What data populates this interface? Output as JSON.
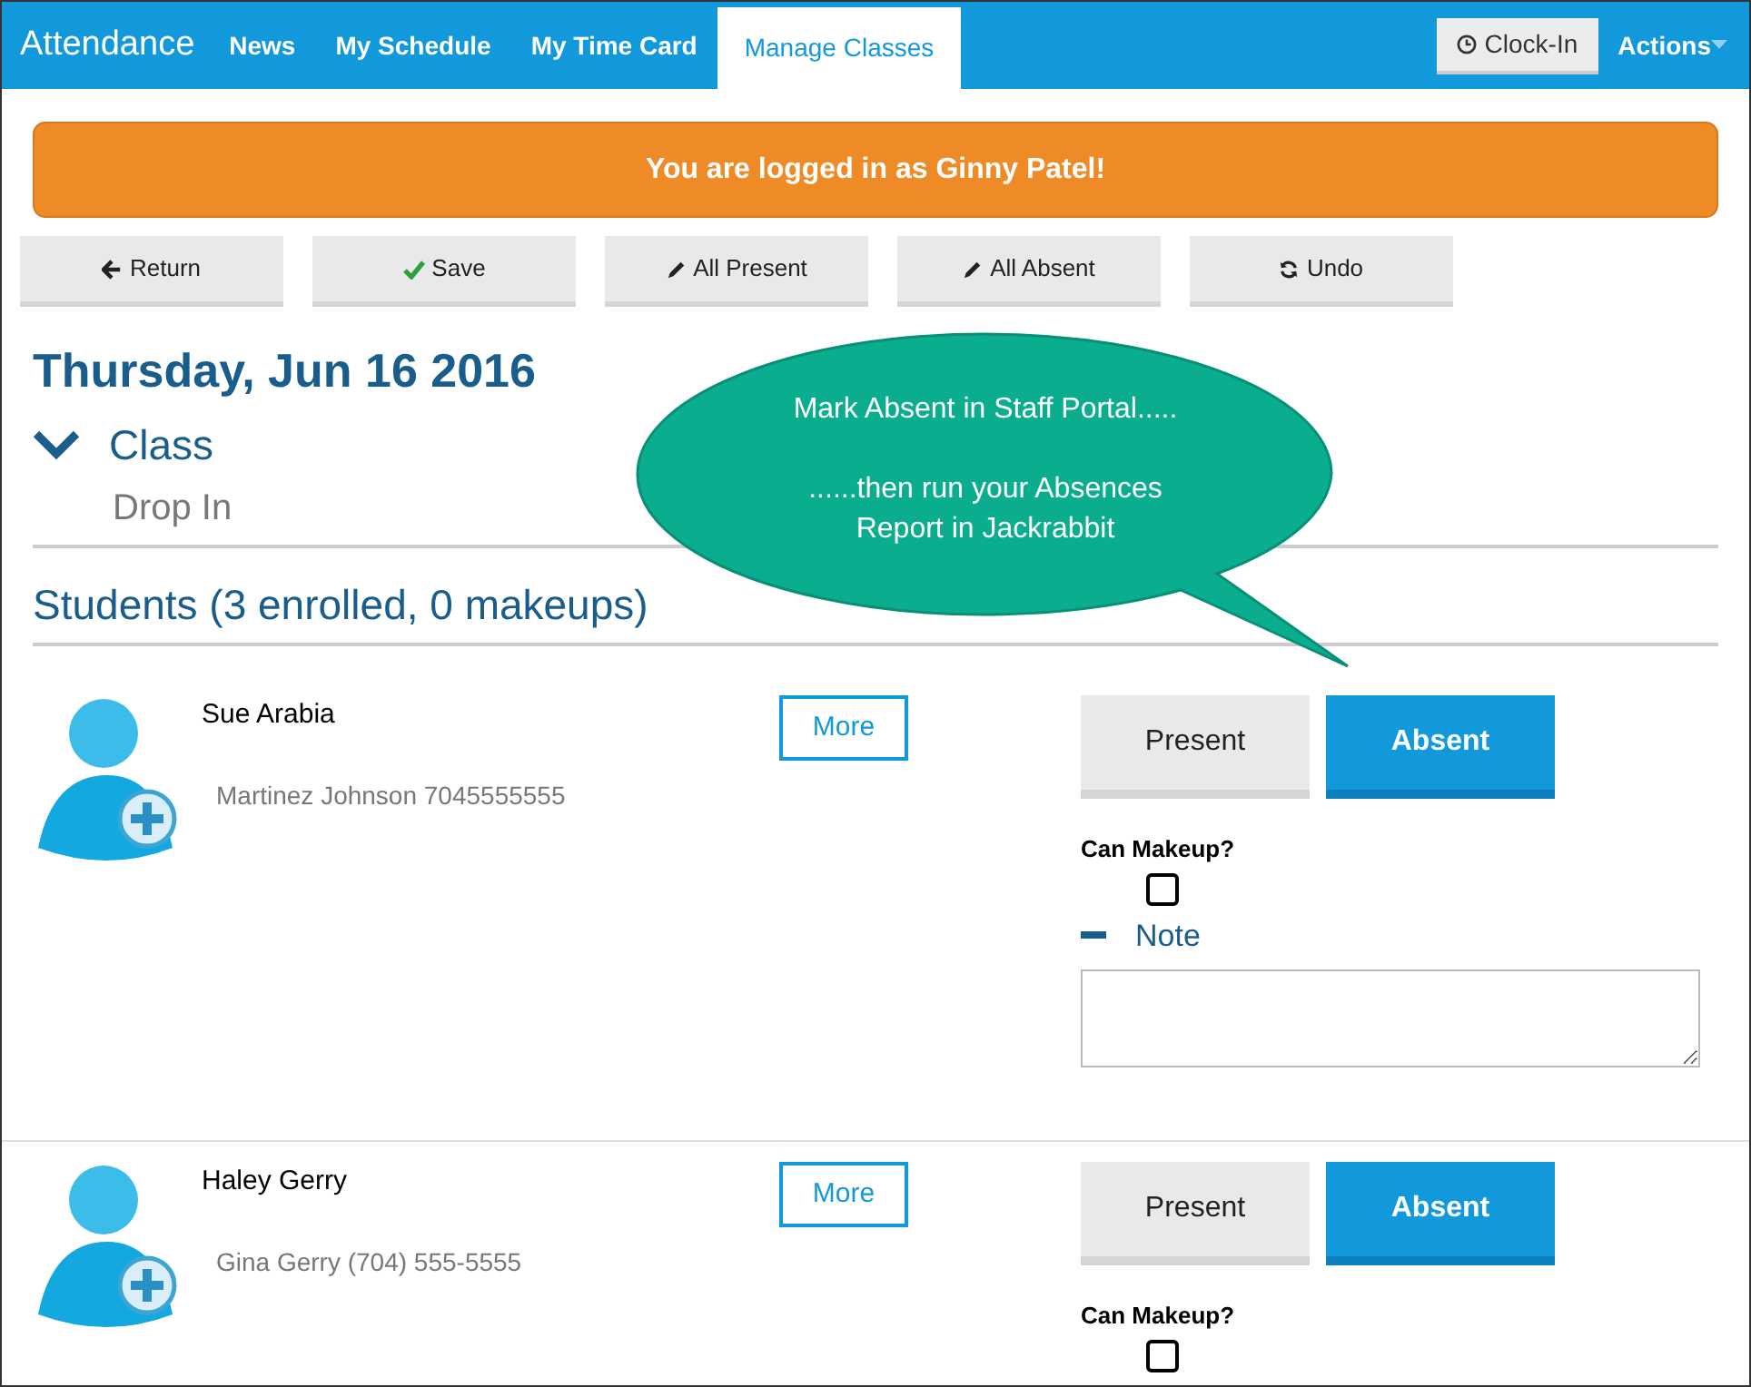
{
  "nav": {
    "brand": "Attendance",
    "tabs": [
      {
        "label": "News",
        "selected": false
      },
      {
        "label": "My Schedule",
        "selected": false
      },
      {
        "label": "My Time Card",
        "selected": false
      },
      {
        "label": "Manage Classes",
        "selected": true
      }
    ],
    "clock_in": "Clock-In",
    "actions": "Actions"
  },
  "alert": "You are logged in as Ginny Patel!",
  "toolbar": [
    {
      "label": "Return"
    },
    {
      "label": "Save"
    },
    {
      "label": "All Present"
    },
    {
      "label": "All Absent"
    },
    {
      "label": "Undo"
    }
  ],
  "date": "Thursday, Jun 16 2016",
  "class": {
    "title": "Class",
    "expanded": true,
    "subtitle": "Drop In"
  },
  "callout": {
    "line1": "Mark Absent in Staff Portal.....",
    "line2": "......then run your Absences Report in Jackrabbit"
  },
  "students_heading": "Students (3 enrolled, 0 makeups)",
  "students": [
    {
      "name": "Sue Arabia",
      "contact": "Martinez Johnson 7045555555",
      "more": "More",
      "options": [
        {
          "label": "Present",
          "selected": false
        },
        {
          "label": "Absent",
          "selected": true
        }
      ],
      "makeup_label": "Can Makeup?",
      "can_makeup": false,
      "note": {
        "label": "Note",
        "expanded": true
      }
    },
    {
      "name": "Haley Gerry",
      "contact": "Gina Gerry (704) 555-5555",
      "more": "More",
      "options": [
        {
          "label": "Present",
          "selected": false
        },
        {
          "label": "Absent",
          "selected": true
        }
      ],
      "makeup_label": "Can Makeup?",
      "can_makeup": false
    }
  ]
}
